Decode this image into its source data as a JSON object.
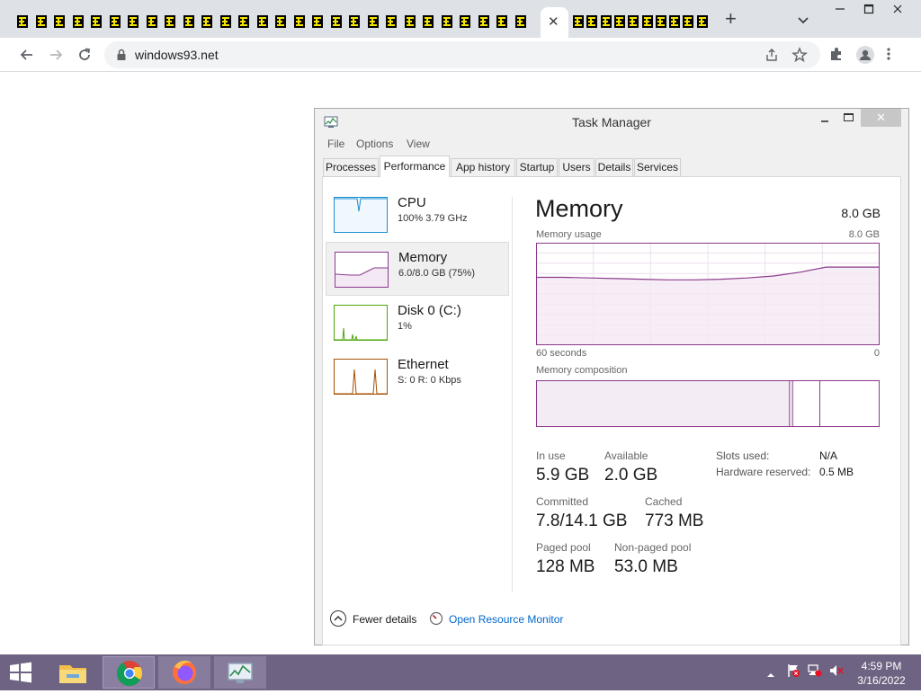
{
  "browser": {
    "tab_count_before_active": 28,
    "tab_count_after_active": 10,
    "active_tab_close": "✕",
    "new_tab": "+",
    "url": "windows93.net",
    "icons": [
      "tab-favicon-icon",
      "close-icon",
      "plus-icon",
      "chevron-down-icon",
      "back-arrow-icon",
      "forward-arrow-icon",
      "reload-icon",
      "lock-icon",
      "share-icon",
      "star-icon",
      "extensions-icon",
      "profile-icon",
      "kebab-menu-icon",
      "minimize-icon",
      "maximize-icon",
      "close-icon"
    ],
    "window_controls": {
      "minimize": "—",
      "maximize": "□",
      "close": "✕"
    }
  },
  "task_manager": {
    "title": "Task Manager",
    "window_controls": {
      "close": "✕"
    },
    "menu": [
      "File",
      "Options",
      "View"
    ],
    "tabs": [
      "Processes",
      "Performance",
      "App history",
      "Startup",
      "Users",
      "Details",
      "Services"
    ],
    "active_tab": "Performance",
    "sidebar": [
      {
        "title": "CPU",
        "subtitle": "100% 3.79 GHz",
        "color": "#1b8fd2"
      },
      {
        "title": "Memory",
        "subtitle": "6.0/8.0 GB (75%)",
        "color": "#8b3a8b"
      },
      {
        "title": "Disk 0 (C:)",
        "subtitle": "1%",
        "color": "#4da60c"
      },
      {
        "title": "Ethernet",
        "subtitle": "S: 0 R: 0 Kbps",
        "color": "#a74f01"
      }
    ],
    "selected_sidebar": "Memory",
    "memory": {
      "title": "Memory",
      "total": "8.0 GB",
      "usage_label": "Memory usage",
      "usage_max": "8.0 GB",
      "time_left": "60 seconds",
      "time_right": "0",
      "composition_label": "Memory composition",
      "usage_series_gb": [
        5.3,
        5.3,
        5.25,
        5.2,
        5.15,
        5.1,
        5.1,
        5.15,
        5.25,
        5.4,
        5.7,
        6.1,
        6.1,
        6.1
      ],
      "composition": {
        "in_use_fraction": 0.74,
        "modified_fraction": 0.01,
        "standby_fraction": 0.08
      },
      "stats": {
        "in_use": {
          "label": "In use",
          "value": "5.9 GB"
        },
        "available": {
          "label": "Available",
          "value": "2.0 GB"
        },
        "committed": {
          "label": "Committed",
          "value": "7.8/14.1 GB"
        },
        "cached": {
          "label": "Cached",
          "value": "773 MB"
        },
        "paged_pool": {
          "label": "Paged pool",
          "value": "128 MB"
        },
        "non_paged_pool": {
          "label": "Non-paged pool",
          "value": "53.0 MB"
        },
        "slots_used": {
          "label": "Slots used:",
          "value": "N/A"
        },
        "hardware_reserved": {
          "label": "Hardware reserved:",
          "value": "0.5 MB"
        }
      }
    },
    "footer": {
      "fewer_details": "Fewer details",
      "resource_monitor": "Open Resource Monitor"
    }
  },
  "taskbar": {
    "apps": [
      "file-explorer-icon",
      "chrome-icon",
      "firefox-icon",
      "task-manager-icon"
    ],
    "clock_time": "4:59 PM",
    "clock_date": "3/16/2022",
    "accent": "#6e6382"
  }
}
